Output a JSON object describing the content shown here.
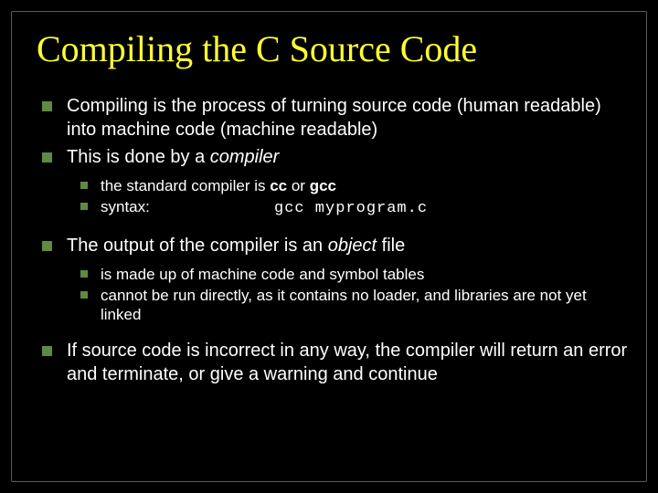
{
  "title": "Compiling the C Source Code",
  "bullets": {
    "b1": "Compiling is the process of turning source code (human readable) into machine code (machine readable)",
    "b2_pre": "This is done by a ",
    "b2_em": "compiler",
    "b2a_pre": "the standard compiler is ",
    "b2a_bold1": "cc",
    "b2a_mid": " or ",
    "b2a_bold2": "gcc",
    "b2b_label": "syntax:",
    "b2b_code": "gcc myprogram.c",
    "b3_pre": "The output of the compiler is an ",
    "b3_em": "object",
    "b3_post": " file",
    "b3a": "is made up of machine code and symbol tables",
    "b3b": "cannot be run directly, as it contains no loader, and libraries are not yet linked",
    "b4": "If source code is incorrect in any way, the compiler will return an error and terminate, or give a warning and continue"
  }
}
